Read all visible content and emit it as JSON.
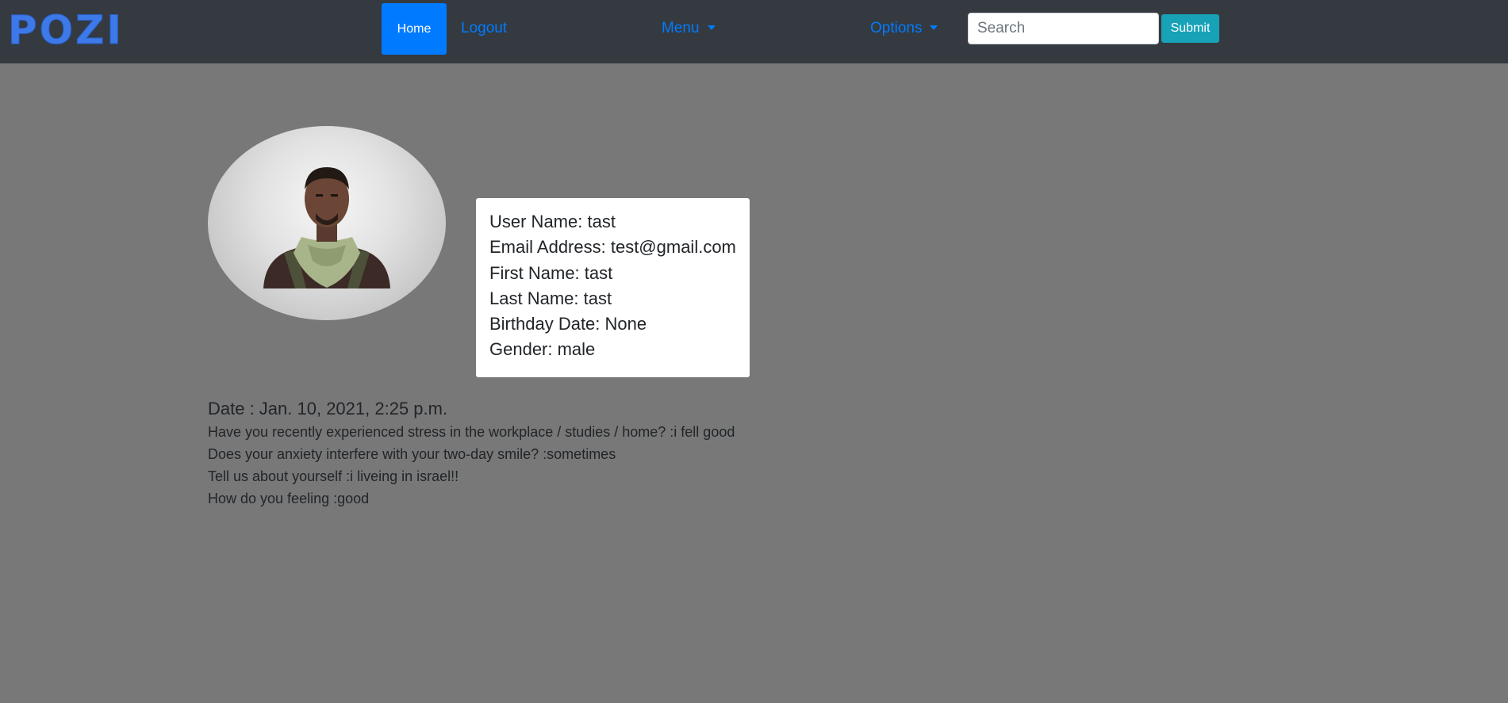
{
  "brand": {
    "logo_text": "POZI",
    "accent": "#3d79e8"
  },
  "nav": {
    "home_label": "Home",
    "logout_label": "Logout",
    "menu_label": "Menu",
    "options_label": "Options",
    "search": {
      "placeholder": "Search",
      "value": ""
    },
    "submit_label": "Submit"
  },
  "profile": {
    "avatar_icon": "user-avatar-portrait",
    "lines": [
      "User Name: tast",
      "Email Address: test@gmail.com",
      "First Name: tast",
      "Last Name: tast",
      "Birthday Date: None",
      "Gender: male"
    ]
  },
  "entry": {
    "date": "Date : Jan. 10, 2021, 2:25 p.m.",
    "answers": [
      "Have you recently experienced stress in the workplace / studies / home? :i fell good",
      "Does your anxiety interfere with your two-day smile? :sometimes",
      "Tell us about yourself :i liveing in israel!!",
      "How do you feeling :good"
    ]
  },
  "colors": {
    "navbar_bg": "#343a40",
    "page_bg": "#787878",
    "primary": "#007bff",
    "info": "#17a2b8"
  }
}
